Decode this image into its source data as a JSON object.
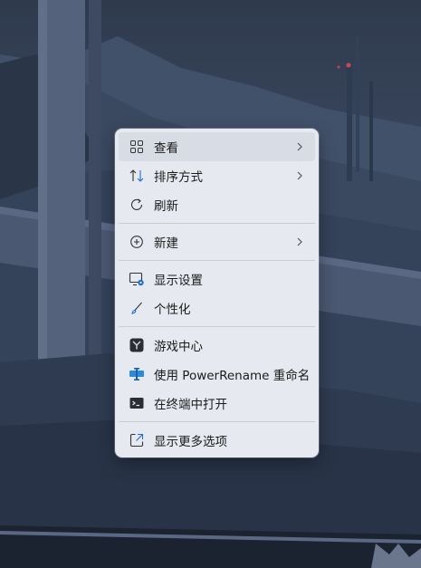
{
  "context_menu": {
    "items": [
      {
        "label": "查看",
        "icon": "view-grid-icon",
        "submenu": true
      },
      {
        "label": "排序方式",
        "icon": "sort-icon",
        "submenu": true
      },
      {
        "label": "刷新",
        "icon": "refresh-icon",
        "submenu": false
      },
      {
        "label": "新建",
        "icon": "new-plus-icon",
        "submenu": true
      },
      {
        "label": "显示设置",
        "icon": "display-settings-icon",
        "submenu": false
      },
      {
        "label": "个性化",
        "icon": "personalize-brush-icon",
        "submenu": false
      },
      {
        "label": "游戏中心",
        "icon": "game-center-icon",
        "submenu": false
      },
      {
        "label": "使用 PowerRename 重命名",
        "icon": "powerrename-icon",
        "submenu": false
      },
      {
        "label": "在终端中打开",
        "icon": "terminal-icon",
        "submenu": false
      },
      {
        "label": "显示更多选项",
        "icon": "show-more-options-icon",
        "submenu": false
      }
    ],
    "hover_index": 0
  },
  "colors": {
    "menu_background": "#e6e9ef",
    "hover_background": "#d8dce4",
    "accent_blue": "#1f6fd1"
  }
}
